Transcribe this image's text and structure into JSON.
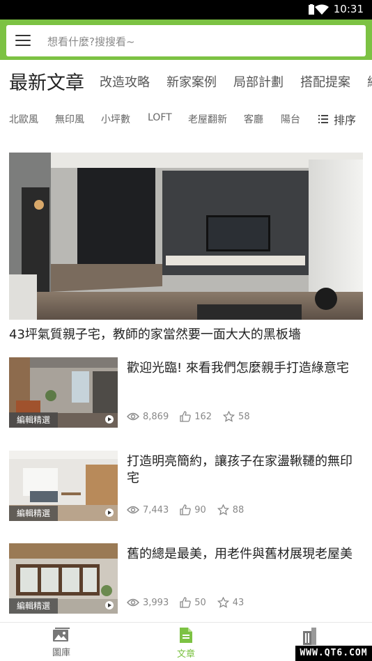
{
  "statusbar": {
    "time": "10:31"
  },
  "search": {
    "placeholder": "想看什麼?搜搜看~"
  },
  "tabs": [
    {
      "label": "最新文章",
      "active": true
    },
    {
      "label": "改造攻略"
    },
    {
      "label": "新家案例"
    },
    {
      "label": "局部計劃"
    },
    {
      "label": "搭配提案"
    },
    {
      "label": "綠"
    }
  ],
  "tags": [
    "北歐風",
    "無印風",
    "小坪數",
    "LOFT",
    "老屋翻新",
    "客廳",
    "陽台"
  ],
  "sort_label": "排序",
  "hero": {
    "title": "43坪氣質親子宅，教師的家當然要一面大大的黑板墻"
  },
  "articles": [
    {
      "badge": "編輯精選",
      "title": "歡迎光臨! 來看我們怎麼親手打造綠意宅",
      "views": "8,869",
      "likes": "162",
      "stars": "58"
    },
    {
      "badge": "編輯精選",
      "title": "打造明亮簡約，讓孩子在家盪鞦韆的無印宅",
      "views": "7,443",
      "likes": "90",
      "stars": "88"
    },
    {
      "badge": "編輯精選",
      "title": "舊的總是最美，用老件與舊材展現老屋美",
      "views": "3,993",
      "likes": "50",
      "stars": "43"
    }
  ],
  "bottomnav": [
    {
      "label": "圖庫"
    },
    {
      "label": "文章",
      "active": true
    },
    {
      "label": ""
    }
  ],
  "watermark": "WWW.QT6.COM",
  "colors": {
    "accent": "#7cc243"
  }
}
